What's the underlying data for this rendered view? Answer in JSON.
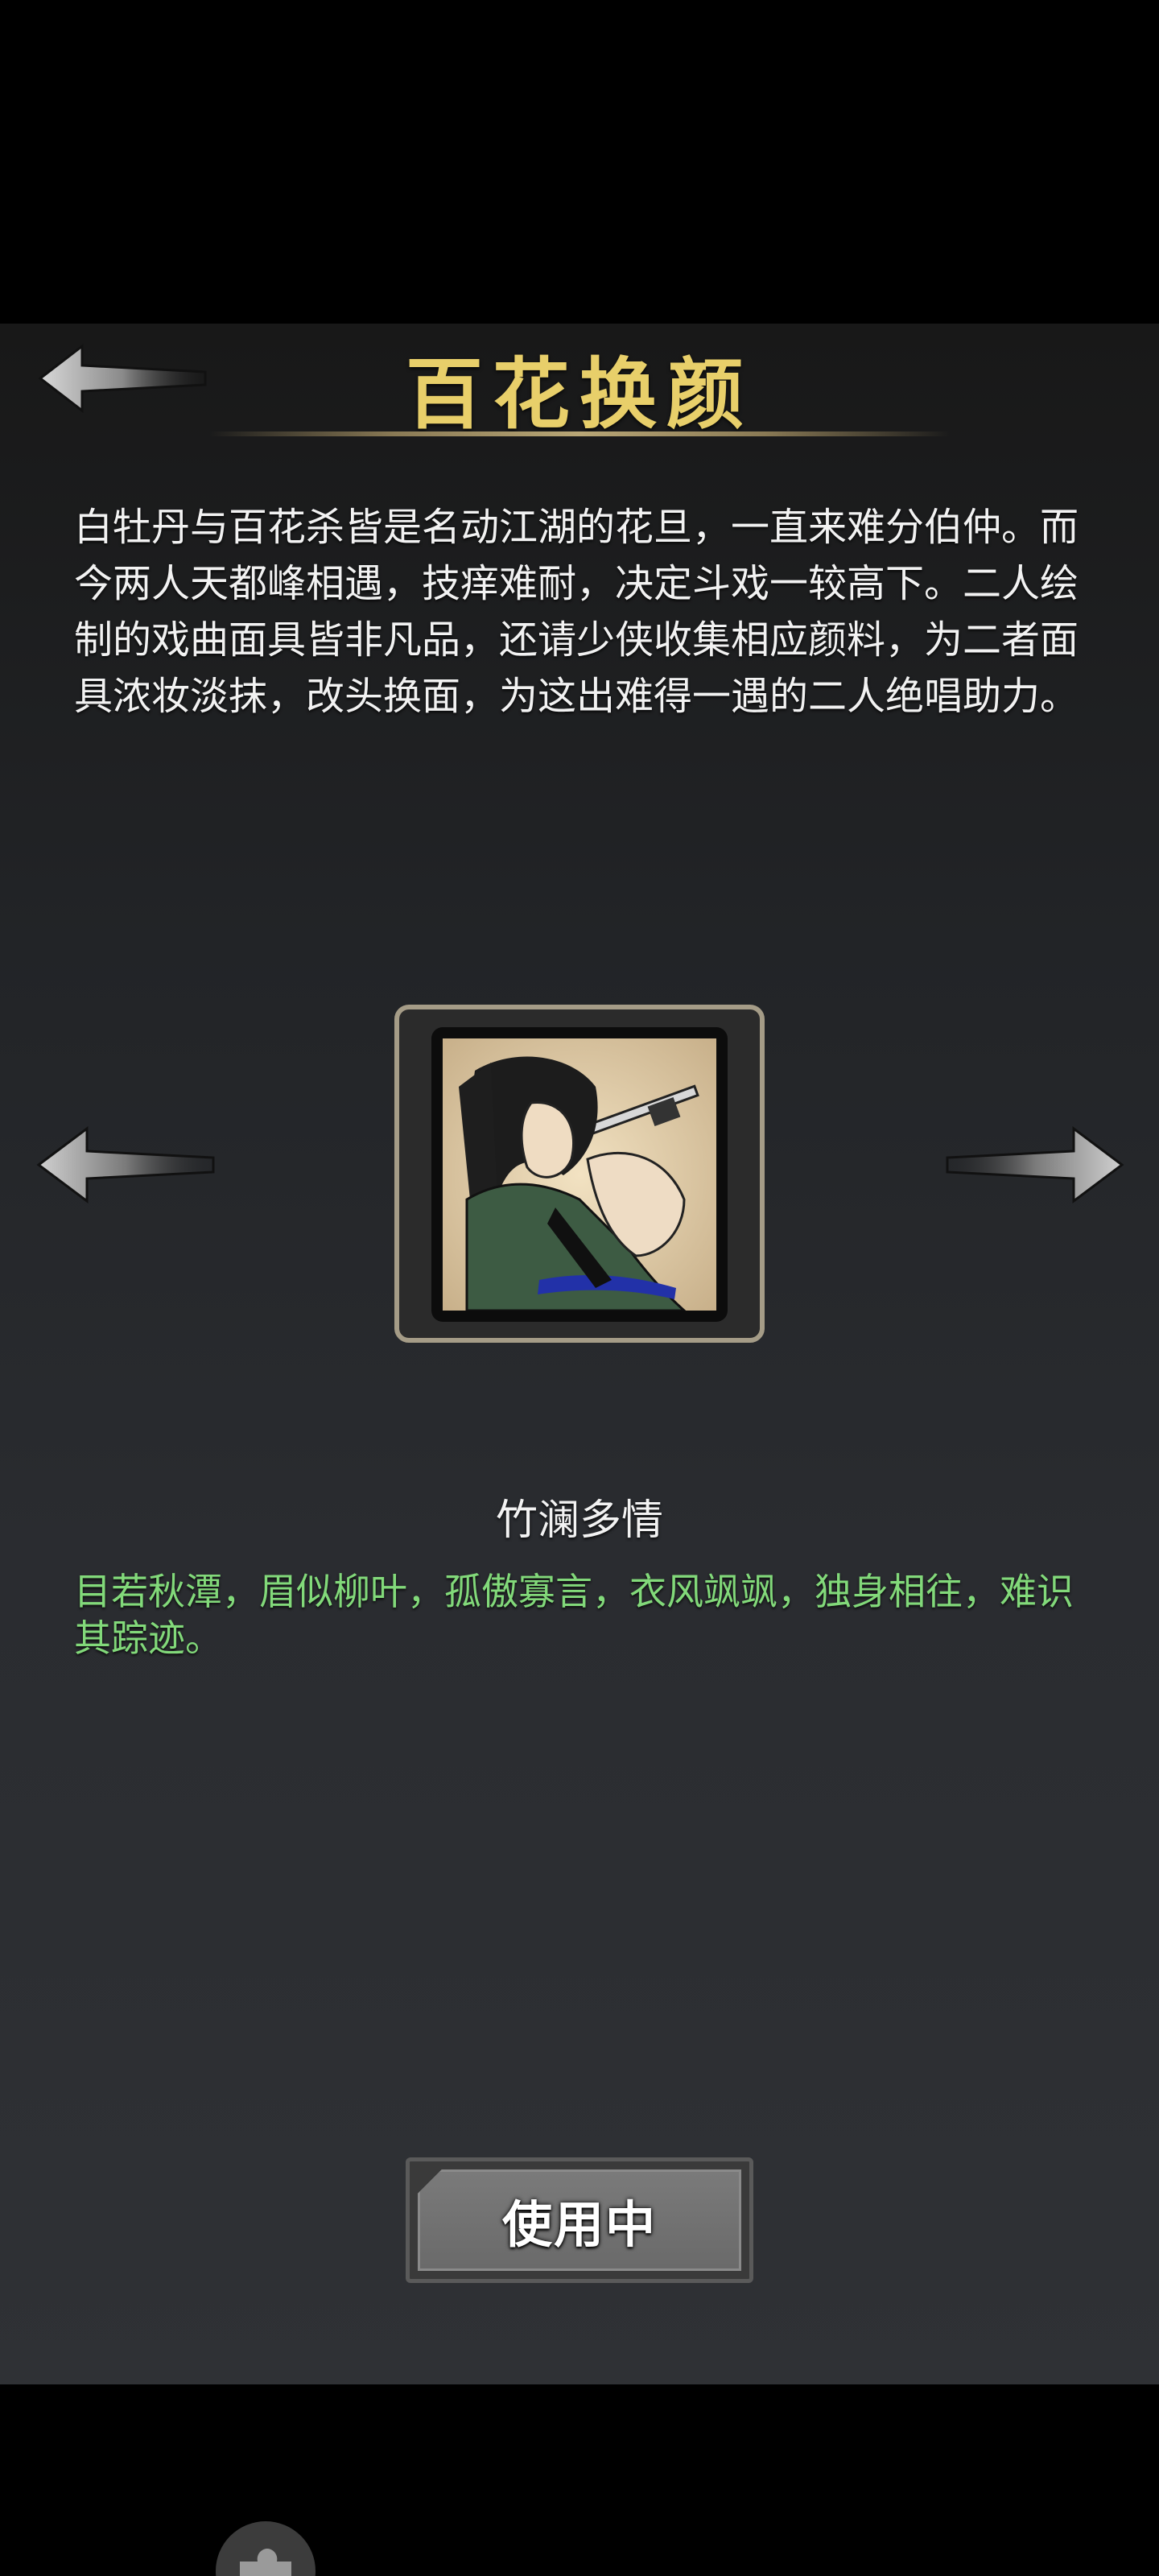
{
  "header": {
    "title": "百花换颜",
    "back_icon": "back-arrow-icon"
  },
  "event": {
    "description": "白牡丹与百花杀皆是名动江湖的花旦，一直来难分伯仲。而今两人天都峰相遇，技痒难耐，决定斗戏一较高下。二人绘制的戏曲面具皆非凡品，还请少侠收集相应颜料，为二者面具浓妆淡抹，改头换面，为这出难得一遇的二人绝唱助力。"
  },
  "carousel": {
    "prev_icon": "left-arrow-icon",
    "next_icon": "right-arrow-icon",
    "current_item": {
      "name": "竹澜多情",
      "description": "目若秋潭，眉似柳叶，孤傲寡言，衣风飒飒，独身相往，难识其踪迹。",
      "portrait_icon": "swordsman-portrait"
    }
  },
  "actions": {
    "use_label": "使用中"
  },
  "colors": {
    "title": "#e8cf6a",
    "description_text": "#f2f2f2",
    "item_desc_text": "#82d97a",
    "frame": "#a59c87"
  }
}
